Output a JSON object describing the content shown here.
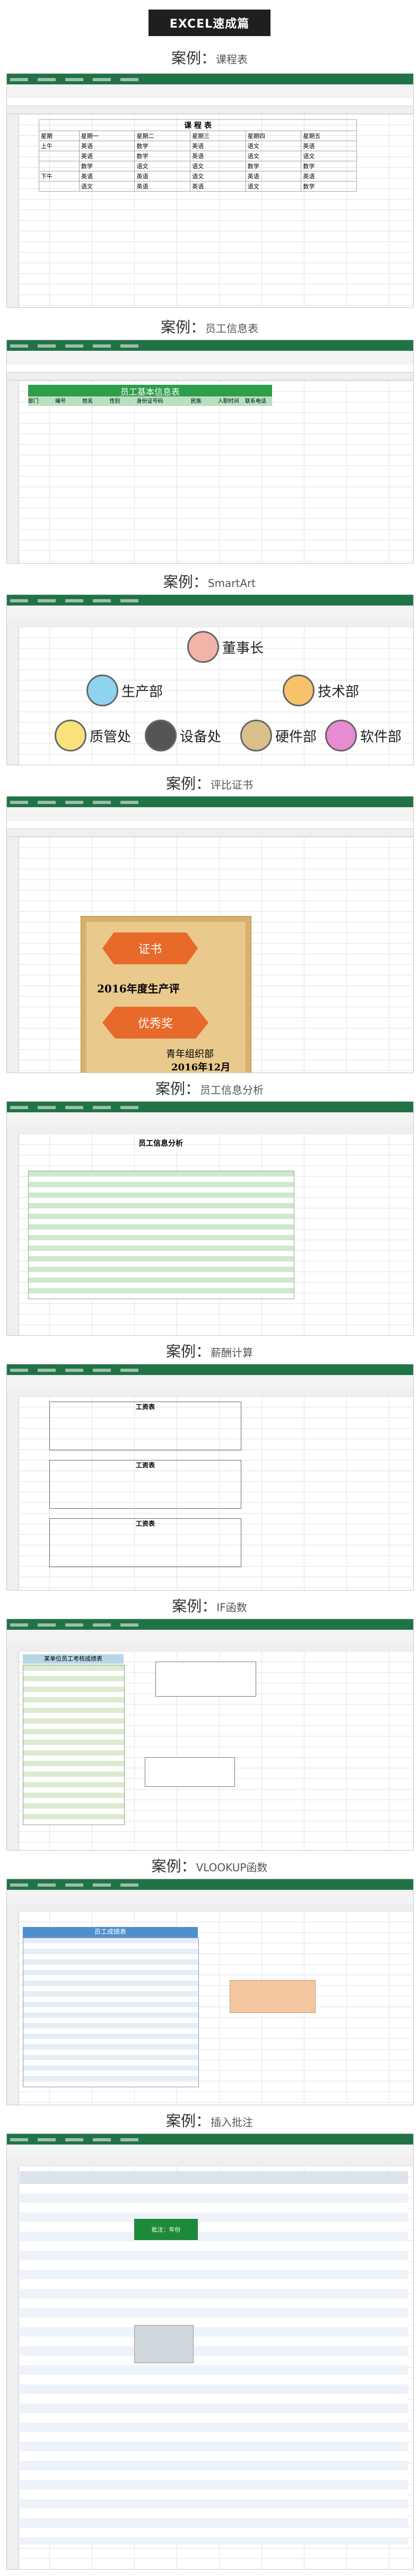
{
  "banner": "EXCEL速成篇",
  "case_prefix": "案例：",
  "cases": [
    {
      "name": "课程表"
    },
    {
      "name": "员工信息表"
    },
    {
      "name": "SmartArt"
    },
    {
      "name": "评比证书"
    },
    {
      "name": "员工信息分析"
    },
    {
      "name": "薪酬计算"
    },
    {
      "name": "IF函数"
    },
    {
      "name": "VLOOKUP函数"
    },
    {
      "name": "插入批注"
    }
  ],
  "schedule": {
    "title": "课 程 表",
    "header": "星期",
    "days": [
      "星期一",
      "星期二",
      "星期三",
      "星期四",
      "星期五"
    ],
    "morning": "上午",
    "afternoon": "下午",
    "rows": [
      [
        "英语",
        "数学",
        "英语",
        "语文",
        "英语"
      ],
      [
        "英语",
        "数学",
        "英语",
        "语文",
        "语文"
      ],
      [
        "数学",
        "语文",
        "语文",
        "数学",
        "数学"
      ],
      [
        "英语",
        "英语",
        "语文",
        "英语",
        "英语"
      ],
      [
        "语文",
        "英语",
        "英语",
        "语文",
        "数学"
      ]
    ]
  },
  "employee": {
    "title": "员工基本信息表",
    "headers": [
      "部门",
      "编号",
      "姓名",
      "性别",
      "身份证号码",
      "民族",
      "入职时间",
      "联系电话"
    ]
  },
  "smartart": {
    "top": "董事长",
    "mid": [
      "生产部",
      "技术部"
    ],
    "leaf": [
      "质管处",
      "设备处",
      "硬件部",
      "软件部"
    ]
  },
  "certificate": {
    "title": "证书",
    "year_line": "2016年度生产评",
    "award": "优秀奖",
    "org": "青年组织部",
    "date": "2016年12月"
  },
  "analysis": {
    "title": "员工信息分析"
  },
  "payroll": {
    "section": "工资表"
  },
  "iffunc": {
    "title": "某单位员工考核成绩表"
  },
  "vlookup": {
    "title": "员工成绩表"
  },
  "comment": {
    "note": "批注：年份"
  }
}
